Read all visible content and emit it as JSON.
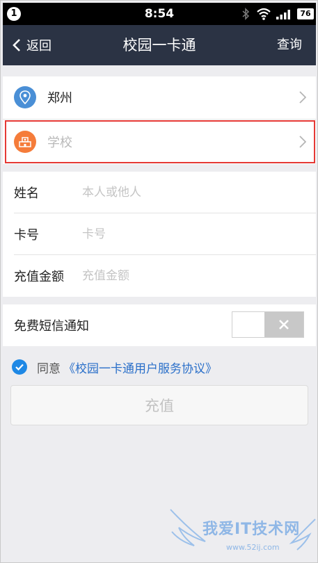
{
  "status_bar": {
    "notification_count": "1",
    "time": "8:54",
    "battery": "76",
    "icons": [
      "bluetooth-icon",
      "wifi-icon",
      "signal-icon",
      "battery-icon"
    ]
  },
  "nav": {
    "back_label": "返回",
    "title": "校园一卡通",
    "action_label": "查询"
  },
  "location": {
    "city": "郑州",
    "school_placeholder": "学校"
  },
  "form": {
    "name_label": "姓名",
    "name_placeholder": "本人或他人",
    "card_label": "卡号",
    "card_placeholder": "卡号",
    "amount_label": "充值金额",
    "amount_placeholder": "充值金额"
  },
  "sms": {
    "label": "免费短信通知",
    "enabled": false
  },
  "agreement": {
    "checked": true,
    "prefix": "同意",
    "link": "《校园一卡通用户服务协议》"
  },
  "submit_label": "充值",
  "watermark": {
    "text": "我爱IT技术网",
    "url": "www.52ij.com"
  },
  "colors": {
    "nav_bg": "#2b3344",
    "location_icon": "#4a8fd6",
    "school_icon": "#f57c3a",
    "link": "#2a6fc9",
    "highlight": "#e53935",
    "check": "#1e88e5"
  }
}
